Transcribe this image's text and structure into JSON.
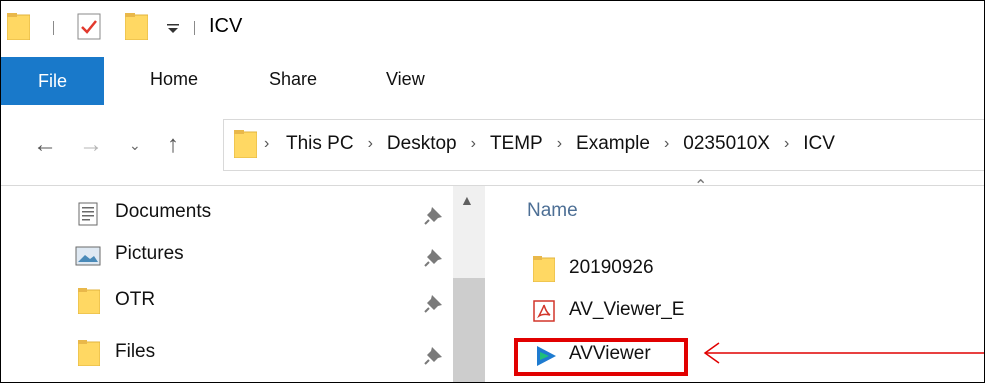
{
  "titlebar": {
    "title": "ICV"
  },
  "ribbon": {
    "tabs": [
      "File",
      "Home",
      "Share",
      "View"
    ]
  },
  "address": {
    "crumbs": [
      "This PC",
      "Desktop",
      "TEMP",
      "Example",
      "0235010X",
      "ICV"
    ]
  },
  "navpane": {
    "items": [
      {
        "label": "Documents",
        "icon": "documents-icon"
      },
      {
        "label": "Pictures",
        "icon": "pictures-icon"
      },
      {
        "label": "OTR",
        "icon": "folder-icon"
      },
      {
        "label": "Files",
        "icon": "folder-icon"
      }
    ]
  },
  "content": {
    "column_name": "Name",
    "files": [
      {
        "name": "20190926",
        "icon": "folder-icon"
      },
      {
        "name": "AV_Viewer_E",
        "icon": "pdf-icon"
      },
      {
        "name": "AVViewer",
        "icon": "avviewer-app-icon"
      }
    ]
  },
  "colors": {
    "accent": "#1979ca",
    "folder": "#ffd863",
    "highlight": "#e10000"
  }
}
